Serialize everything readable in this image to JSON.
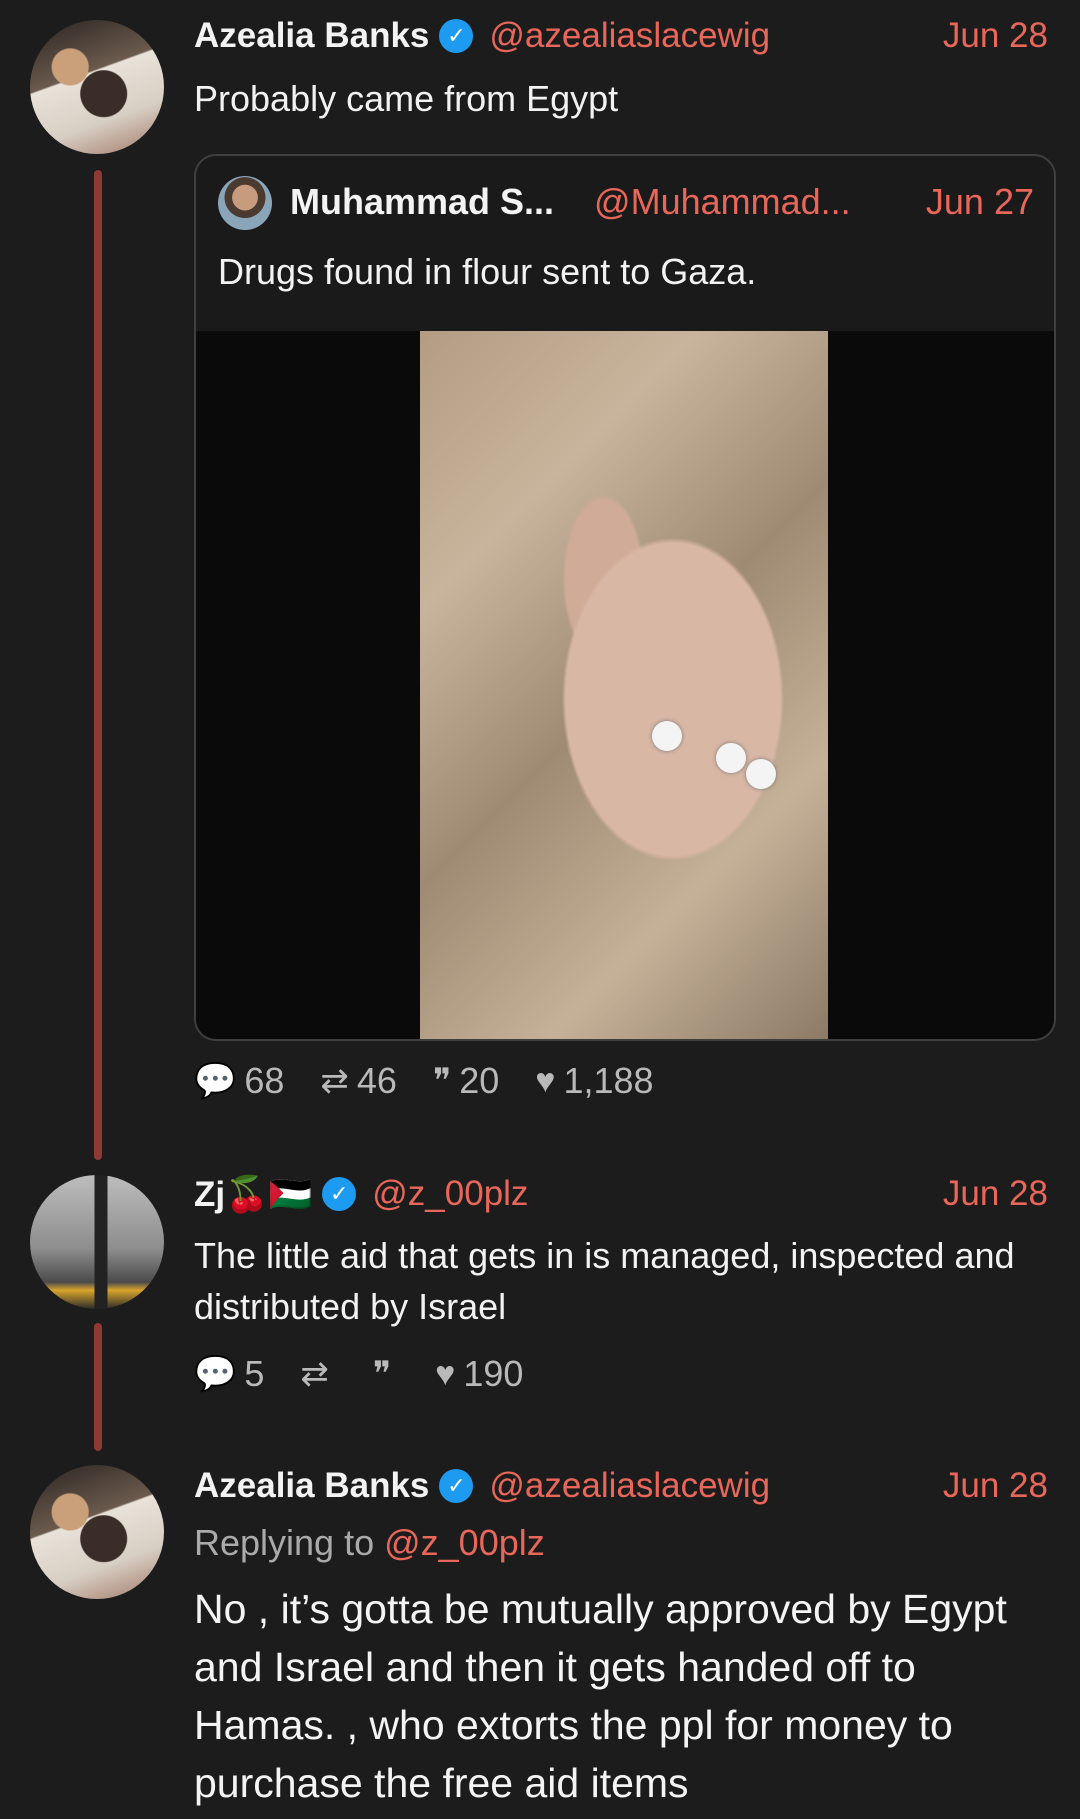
{
  "tweet1": {
    "name": "Azealia Banks",
    "verified_icon": "verified-check-icon",
    "handle": "@azealiaslacewig",
    "date": "Jun 28",
    "text": "Probably came from Egypt",
    "quote": {
      "name": "Muhammad S...",
      "handle": "@Muhammad...",
      "date": "Jun 27",
      "text": "Drugs found in flour sent to Gaza."
    },
    "stats": {
      "replies": "68",
      "retweets": "46",
      "quotes": "20",
      "likes": "1,188"
    }
  },
  "tweet2": {
    "name": "Zj🍒🇵🇸",
    "handle": "@z_00plz",
    "date": "Jun 28",
    "text": "The little aid that gets in is managed, inspected and distributed by Israel",
    "stats": {
      "replies": "5",
      "retweets": "",
      "quotes": "",
      "likes": "190"
    }
  },
  "tweet3": {
    "name": "Azealia Banks",
    "handle": "@azealiaslacewig",
    "date": "Jun 28",
    "replying_prefix": "Replying to ",
    "replying_to": "@z_00plz",
    "text": "No , it’s gotta be mutually approved by Egypt and Israel and then it gets handed off to Hamas. , who extorts the ppl for money to purchase the free aid items"
  },
  "icons": {
    "reply": "speech-bubble-icon",
    "retweet": "retweet-icon",
    "quote": "quote-icon",
    "like": "heart-icon"
  },
  "colors": {
    "accent": "#e8675a",
    "thread": "#8d3a34",
    "verified": "#1d9bf0",
    "background": "#1c1c1c"
  }
}
